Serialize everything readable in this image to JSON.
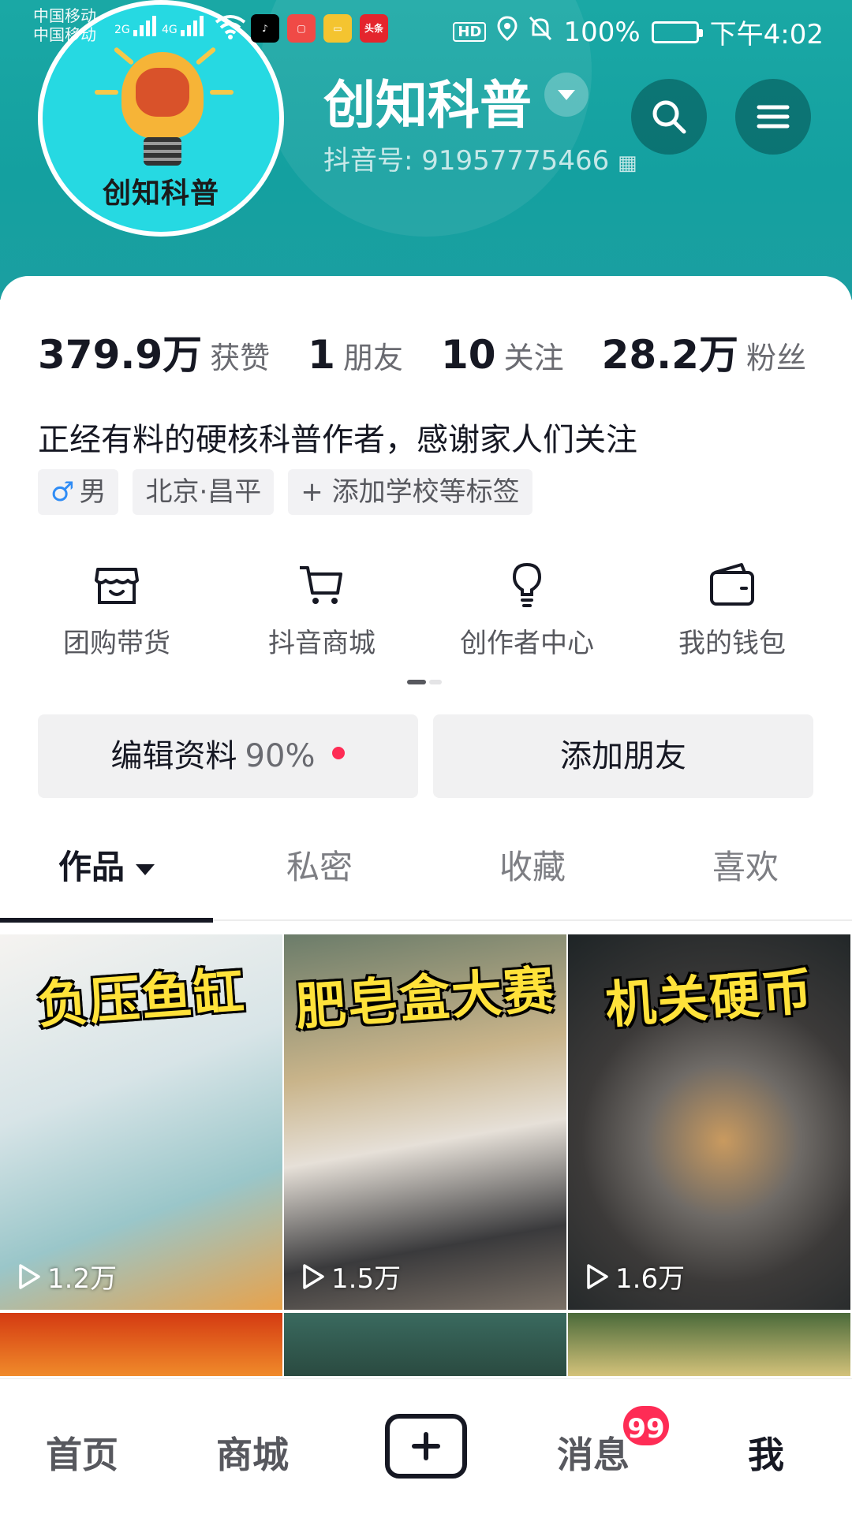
{
  "status_bar": {
    "carrier_1": "中国移动",
    "carrier_2": "中国移动",
    "net_1": "2G",
    "net_2": "4G",
    "hd": "HD",
    "battery_pct": "100%",
    "time": "下午4:02",
    "app_icons": [
      "tiktok-icon",
      "vmall-icon",
      "files-icon",
      "toutiao-icon"
    ],
    "toutiao_label": "头条"
  },
  "profile": {
    "avatar_text": "创知科普",
    "name": "创知科普",
    "douyin_id": "抖音号: 91957775466"
  },
  "stats": [
    {
      "num": "379.9万",
      "label": "获赞"
    },
    {
      "num": "1",
      "label": "朋友"
    },
    {
      "num": "10",
      "label": "关注"
    },
    {
      "num": "28.2万",
      "label": "粉丝"
    }
  ],
  "bio": "正经有料的硬核科普作者，感谢家人们关注",
  "tags": {
    "gender_symbol": "♂",
    "gender": "男",
    "location": "北京·昌平",
    "add_tag": "+ 添加学校等标签"
  },
  "quick_actions": [
    {
      "label": "团购带货",
      "icon": "storefront-icon"
    },
    {
      "label": "抖音商城",
      "icon": "shopping-cart-icon"
    },
    {
      "label": "创作者中心",
      "icon": "lightbulb-icon"
    },
    {
      "label": "我的钱包",
      "icon": "wallet-icon"
    }
  ],
  "buttons": {
    "edit": "编辑资料",
    "edit_pct": "90%",
    "add_friend": "添加朋友"
  },
  "tabs": [
    "作品",
    "私密",
    "收藏",
    "喜欢"
  ],
  "videos": [
    {
      "title": "负压鱼缸",
      "views": "1.2万"
    },
    {
      "title": "肥皂盒大赛",
      "views": "1.5万"
    },
    {
      "title": "机关硬币",
      "views": "1.6万"
    }
  ],
  "nav": {
    "home": "首页",
    "mall": "商城",
    "messages": "消息",
    "badge": "99",
    "me": "我"
  },
  "colors": {
    "header_teal": "#1aa8a5",
    "accent_red": "#fe2c55",
    "text_primary": "#161823"
  }
}
